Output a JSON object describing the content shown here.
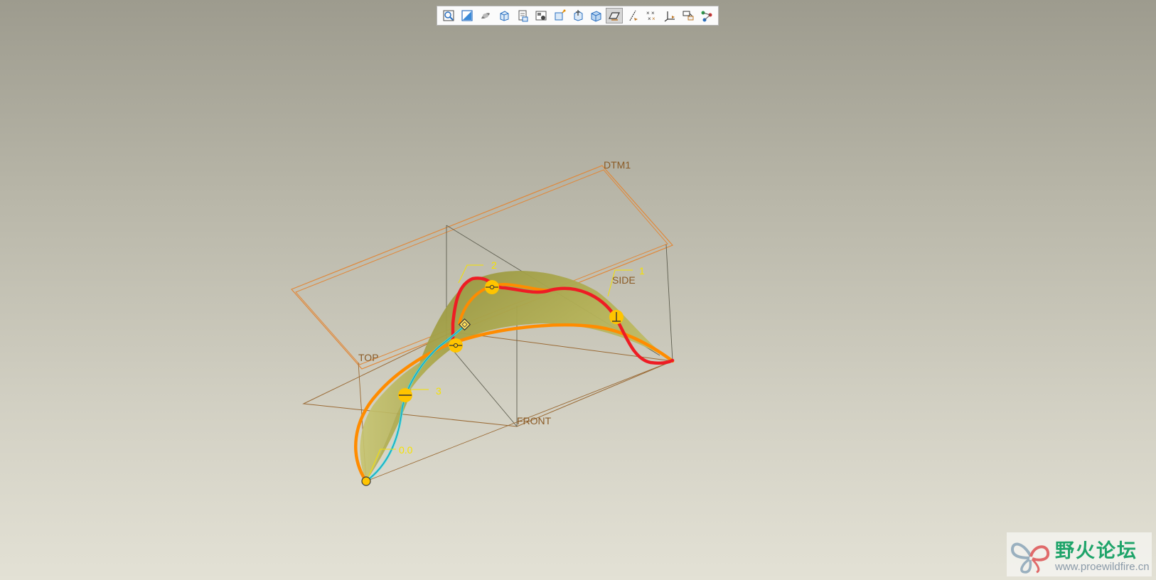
{
  "toolbar": {
    "buttons": [
      {
        "name": "zoom-fit-icon"
      },
      {
        "name": "repaint-icon"
      },
      {
        "name": "shading-icon"
      },
      {
        "name": "box-view-icon"
      },
      {
        "name": "saved-views-icon"
      },
      {
        "name": "display-style-icon"
      },
      {
        "name": "orient-icon"
      },
      {
        "name": "spin-center-icon"
      },
      {
        "name": "cube-view-icon"
      },
      {
        "name": "datum-planes-icon",
        "active": true
      },
      {
        "name": "datum-axes-icon"
      },
      {
        "name": "datum-points-icon"
      },
      {
        "name": "coordinate-systems-icon"
      },
      {
        "name": "annotation-display-icon"
      },
      {
        "name": "curve-display-icon"
      }
    ]
  },
  "viewport": {
    "datum_labels": {
      "dtm1": "DTM1",
      "side": "SIDE",
      "top": "TOP",
      "front": "FRONT"
    },
    "curve_labels": {
      "c1": "1",
      "c2": "2",
      "c3": "3",
      "c0": "0.0"
    },
    "colors": {
      "surface": "#b9b65a",
      "boundary_orange": "#ff8c00",
      "boundary_red": "#ee1c24",
      "cyan_curve": "#33e0e6",
      "handle": "#ffc400",
      "datum_plane": "#e0883a"
    }
  },
  "watermark": {
    "title": "野火论坛",
    "url": "www.proewildfire.cn"
  }
}
